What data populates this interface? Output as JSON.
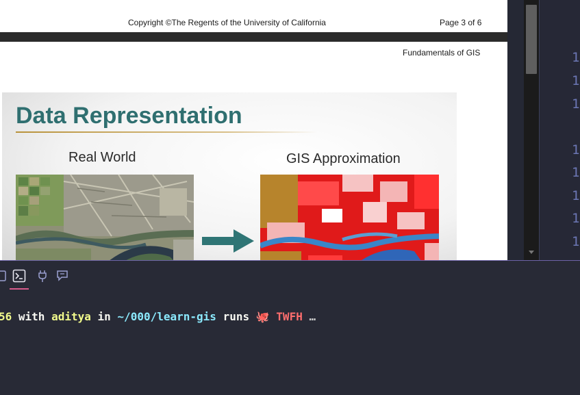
{
  "pdf": {
    "copyright": "Copyright ©The Regents of the University of California",
    "page_indicator": "Page 3 of 6",
    "running_head": "Fundamentals of GIS",
    "slide": {
      "title": "Data Representation",
      "left_label": "Real World",
      "right_label": "GIS Approximation",
      "left_image": "aerial-photo",
      "right_image": "land-cover-raster",
      "arrow_color": "#2f7575"
    }
  },
  "editor": {
    "line_numbers": [
      "1",
      "1",
      "1",
      "1",
      "1",
      "1",
      "1",
      "1"
    ]
  },
  "terminal": {
    "icons": [
      "panel-icon",
      "terminal-icon",
      "plug-icon",
      "chat-icon"
    ],
    "active_tab": "terminal-icon",
    "prompt": {
      "prefix": "56",
      "with_word": "with",
      "user": "aditya",
      "in_word": "in",
      "path": "~/000/learn-gis",
      "runs_word": "runs",
      "emoji": "🐙",
      "project": "TWFH",
      "ellipsis": "…"
    }
  },
  "colors": {
    "accent": "#d85c8c",
    "slide_title": "#2f6f70",
    "gutter_numbers": "#6c77b5"
  }
}
